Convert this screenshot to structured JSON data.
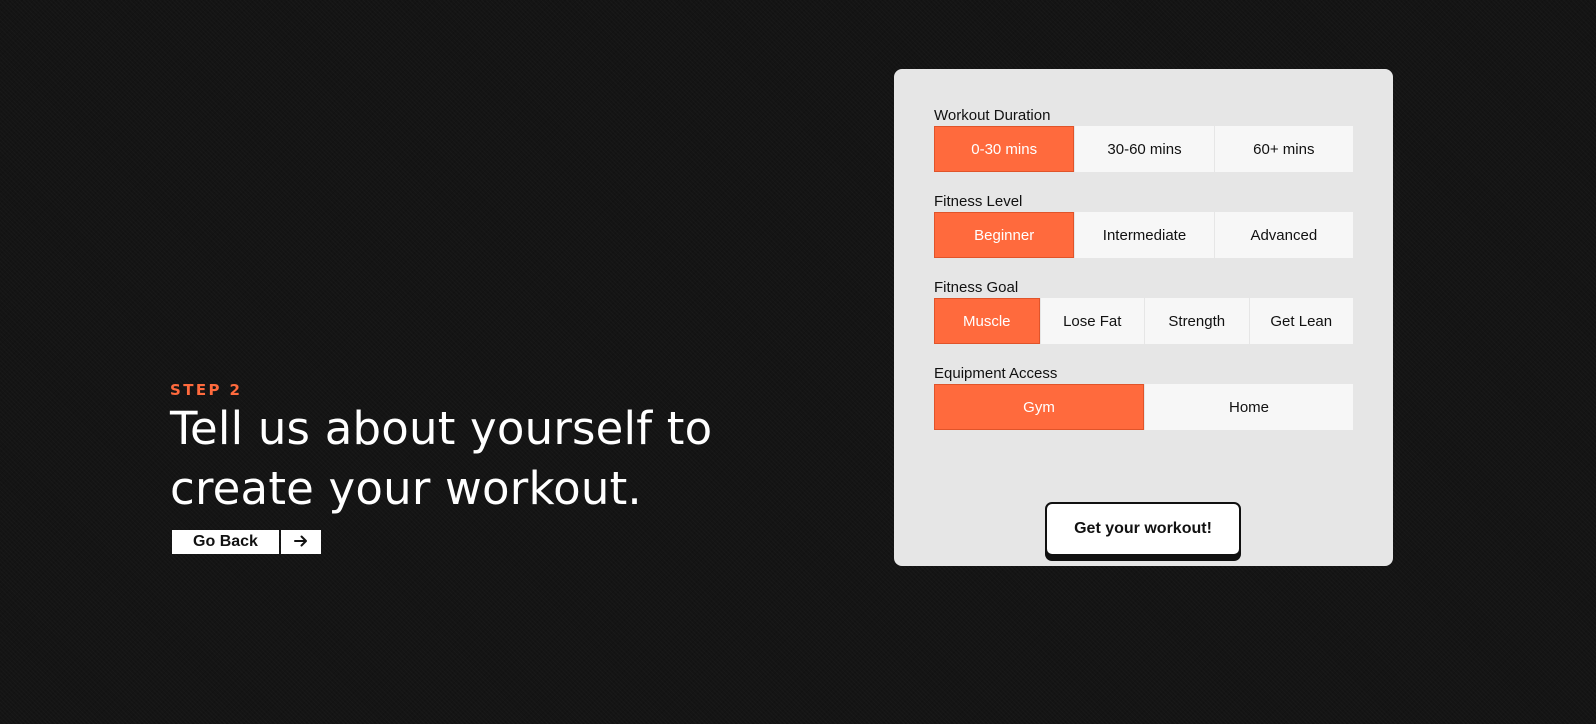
{
  "colors": {
    "accent": "#ff6a3d",
    "background": "#141414",
    "card": "#e6e6e6",
    "option": "#f7f7f7"
  },
  "intro": {
    "step_label": "STEP 2",
    "headline": "Tell us about yourself to create your workout.",
    "back_label": "Go Back",
    "arrow_icon": "arrow-right-icon"
  },
  "form": {
    "groups": [
      {
        "label": "Workout Duration",
        "options": [
          "0-30 mins",
          "30-60 mins",
          "60+ mins"
        ],
        "selected": "0-30 mins"
      },
      {
        "label": "Fitness Level",
        "options": [
          "Beginner",
          "Intermediate",
          "Advanced"
        ],
        "selected": "Beginner"
      },
      {
        "label": "Fitness Goal",
        "options": [
          "Muscle",
          "Lose Fat",
          "Strength",
          "Get Lean"
        ],
        "selected": "Muscle"
      },
      {
        "label": "Equipment Access",
        "options": [
          "Gym",
          "Home"
        ],
        "selected": "Gym"
      }
    ],
    "submit_label": "Get your workout!"
  }
}
